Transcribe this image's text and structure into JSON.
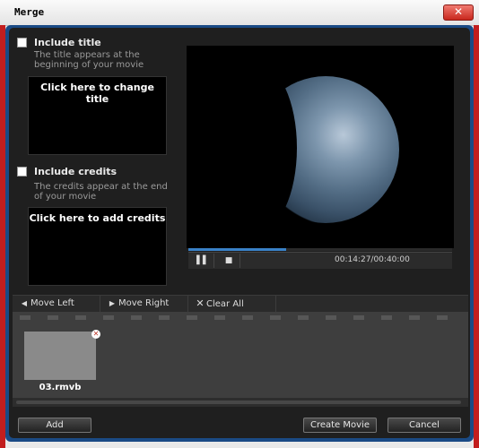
{
  "window": {
    "title": "Merge",
    "close_glyph": "✕"
  },
  "title_section": {
    "checkbox_label": "Include title",
    "description": "The title appears at the beginning of your movie",
    "box_text": "Click here to change title"
  },
  "credits_section": {
    "checkbox_label": "Include credits",
    "description": "The credits appear at the end of your movie",
    "box_text": "Click here to add credits"
  },
  "player": {
    "time": "00:14:27/00:40:00",
    "progress": 0.37,
    "pause_glyph": "▌▌",
    "stop_glyph": "■"
  },
  "clip_toolbar": {
    "move_left": "Move Left",
    "move_right": "Move Right",
    "clear_all": "Clear All"
  },
  "clips": [
    {
      "name": "03.rmvb"
    }
  ],
  "buttons": {
    "add": "Add",
    "create_movie": "Create Movie",
    "cancel": "Cancel"
  },
  "colors": {
    "accent_blue": "#1a4a85",
    "close_red": "#c8271d",
    "progress": "#3a82c8"
  }
}
